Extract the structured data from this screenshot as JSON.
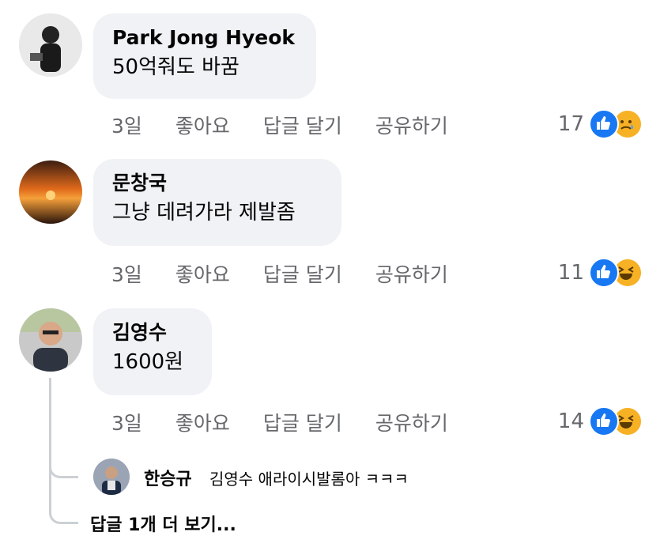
{
  "comments": [
    {
      "author": "Park Jong Hyeok",
      "text": "50억줘도 바꿈",
      "time": "3일",
      "like": "좋아요",
      "reply": "답글 달기",
      "share": "공유하기",
      "reaction_count": "17",
      "reactions": [
        "like-icon",
        "sad-icon"
      ]
    },
    {
      "author": "문창국",
      "text": "그냥 데려가라 제발좀",
      "time": "3일",
      "like": "좋아요",
      "reply": "답글 달기",
      "share": "공유하기",
      "reaction_count": "11",
      "reactions": [
        "like-icon",
        "haha-icon"
      ]
    },
    {
      "author": "김영수",
      "text": "1600원",
      "time": "3일",
      "like": "좋아요",
      "reply": "답글 달기",
      "share": "공유하기",
      "reaction_count": "14",
      "reactions": [
        "like-icon",
        "haha-icon"
      ]
    }
  ],
  "reply": {
    "author": "한승규",
    "text": "김영수 애라이시발롬아 ㅋㅋㅋ"
  },
  "more_replies": "답글 1개 더 보기...",
  "colors": {
    "like_blue": "#1877f2",
    "emoji_yellow": "#f7b125",
    "bubble_bg": "#f0f2f5",
    "meta_gray": "#65676b"
  }
}
